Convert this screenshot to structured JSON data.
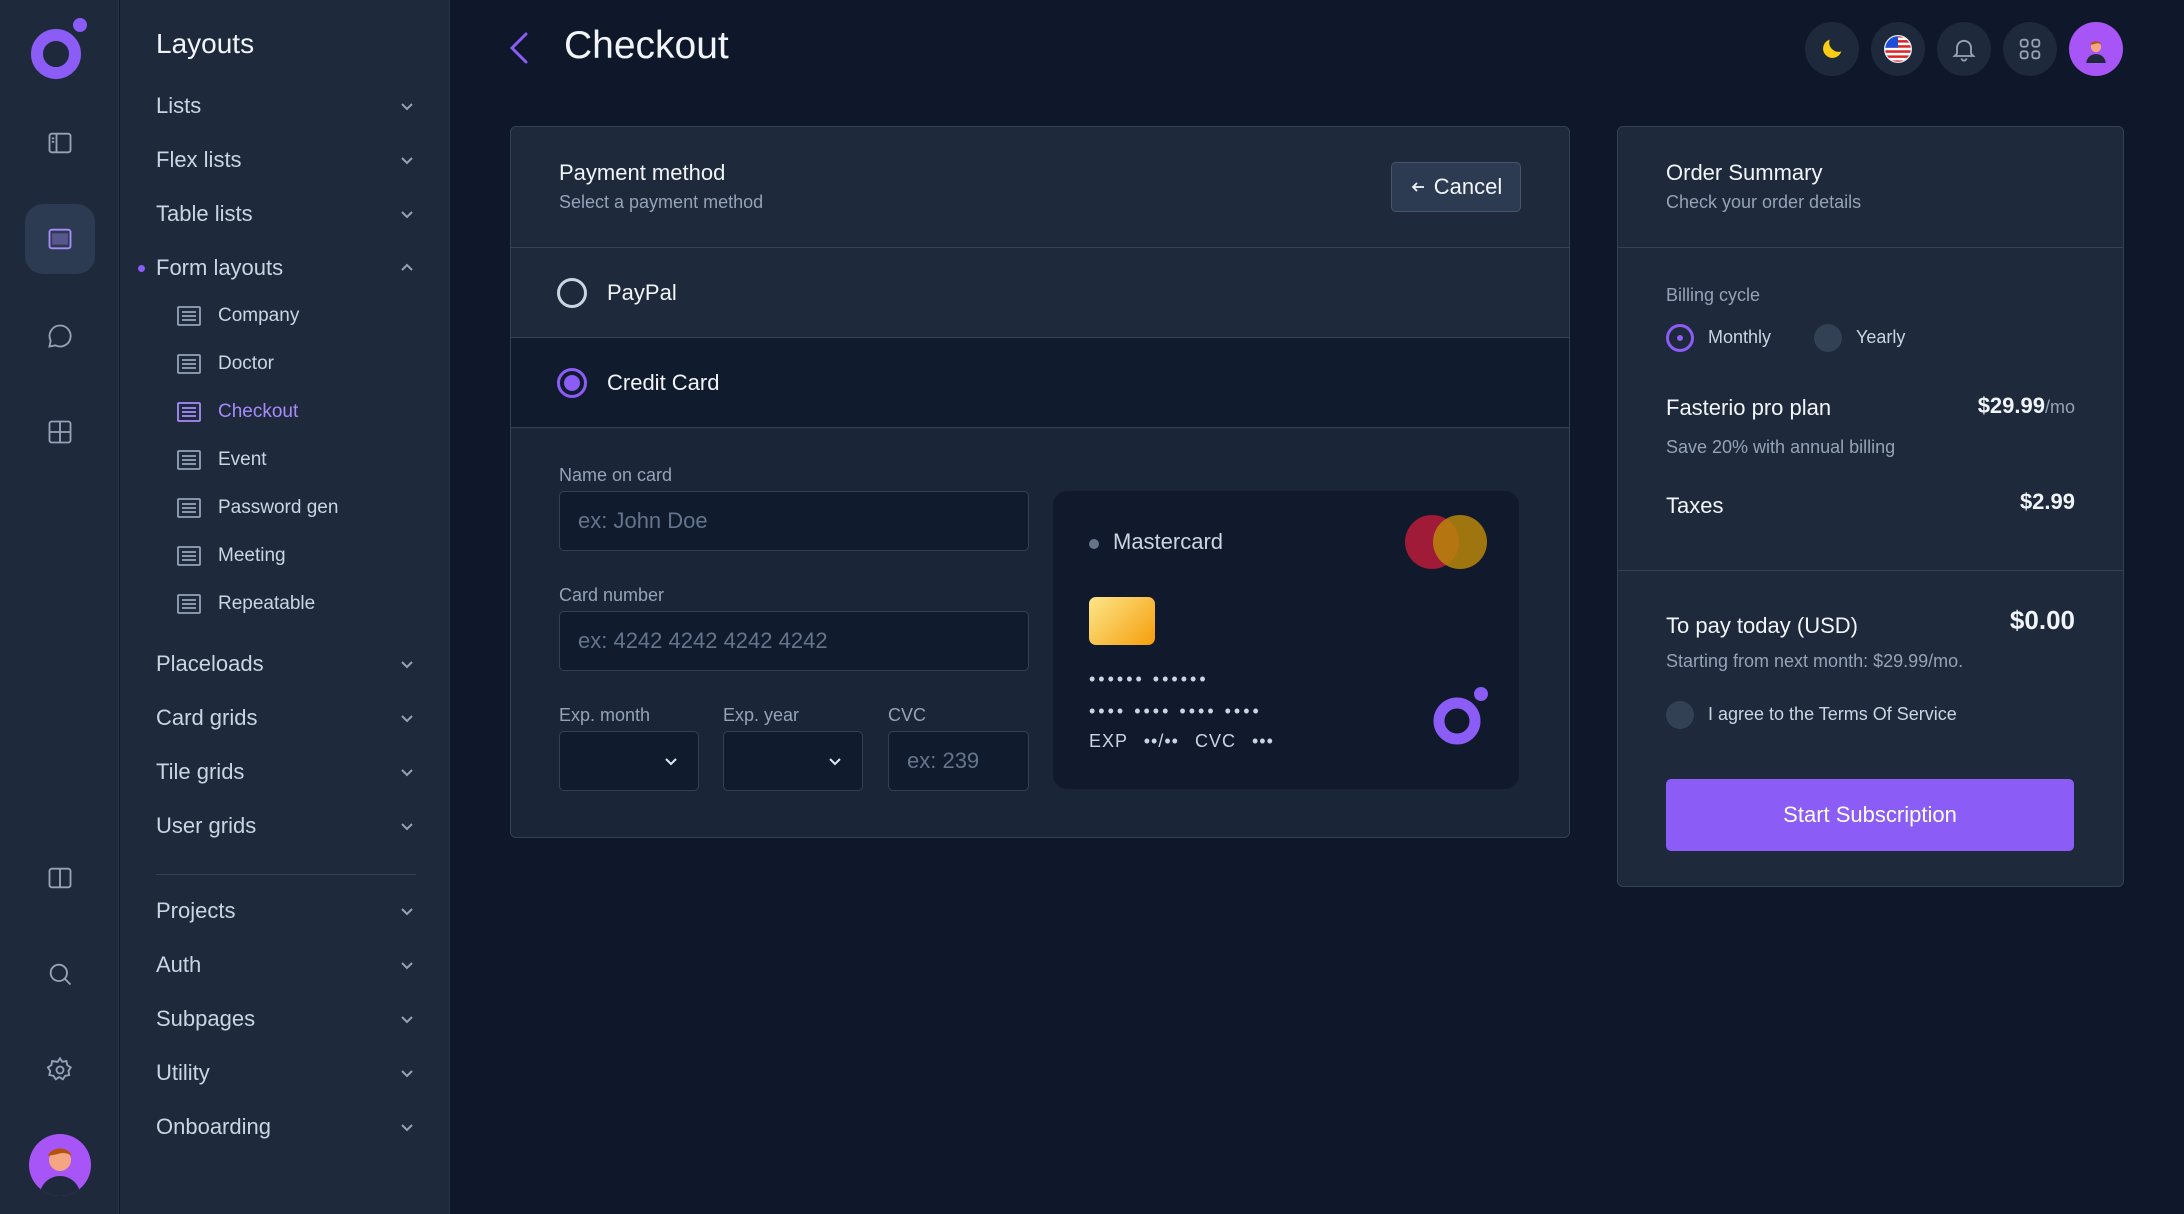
{
  "header": {
    "title": "Checkout",
    "icons": [
      "moon-icon",
      "us-flag-icon",
      "bell-icon",
      "apps-grid-icon",
      "user-avatar"
    ]
  },
  "rail": {
    "items": [
      "sidebar-panel-icon",
      "layout-window-icon",
      "chat-bubble-icon",
      "grid-icon",
      "columns-icon",
      "search-icon",
      "gear-icon"
    ],
    "active": "layout-window-icon"
  },
  "menu": {
    "title": "Layouts",
    "items": [
      {
        "label": "Lists"
      },
      {
        "label": "Flex lists"
      },
      {
        "label": "Table lists"
      },
      {
        "label": "Form layouts",
        "expanded": true
      },
      {
        "label": "Placeloads"
      },
      {
        "label": "Card grids"
      },
      {
        "label": "Tile grids"
      },
      {
        "label": "User grids"
      },
      {
        "label": "Projects"
      },
      {
        "label": "Auth"
      },
      {
        "label": "Subpages"
      },
      {
        "label": "Utility"
      },
      {
        "label": "Onboarding"
      }
    ],
    "sub_items": [
      {
        "label": "Company"
      },
      {
        "label": "Doctor"
      },
      {
        "label": "Checkout",
        "active": true
      },
      {
        "label": "Event"
      },
      {
        "label": "Password gen"
      },
      {
        "label": "Meeting"
      },
      {
        "label": "Repeatable"
      }
    ]
  },
  "payment": {
    "title": "Payment method",
    "subtitle": "Select a payment method",
    "cancel_label": "Cancel",
    "options": [
      {
        "label": "PayPal",
        "selected": false
      },
      {
        "label": "Credit Card",
        "selected": true
      }
    ],
    "form": {
      "name_label": "Name on card",
      "name_placeholder": "ex: John Doe",
      "number_label": "Card number",
      "number_placeholder": "ex: 4242 4242 4242 4242",
      "month_label": "Exp. month",
      "year_label": "Exp. year",
      "cvc_label": "CVC",
      "cvc_placeholder": "ex: 239"
    },
    "card_preview": {
      "brand": "Mastercard",
      "line1": "•••••• ••••••",
      "line2": "•••• •••• •••• ••••",
      "exp_label": "EXP",
      "exp_value": "••/••",
      "cvc_label": "CVC",
      "cvc_value": "•••"
    }
  },
  "summary": {
    "title": "Order Summary",
    "subtitle": "Check your order details",
    "billing_label": "Billing cycle",
    "cycles": [
      {
        "label": "Monthly",
        "selected": true
      },
      {
        "label": "Yearly",
        "selected": false
      }
    ],
    "plan_name": "Fasterio pro plan",
    "plan_price": "$29.99",
    "plan_unit": "/mo",
    "plan_note": "Save 20% with annual billing",
    "taxes_label": "Taxes",
    "taxes_value": "$2.99",
    "today_label": "To pay today (USD)",
    "today_value": "$0.00",
    "next_month": "Starting from next month: $29.99/mo.",
    "agree_label": "I agree to the Terms Of Service",
    "button_label": "Start Subscription"
  },
  "colors": {
    "background": "#0f172a",
    "panel": "#1e293b",
    "accent": "#8b5cf6"
  }
}
